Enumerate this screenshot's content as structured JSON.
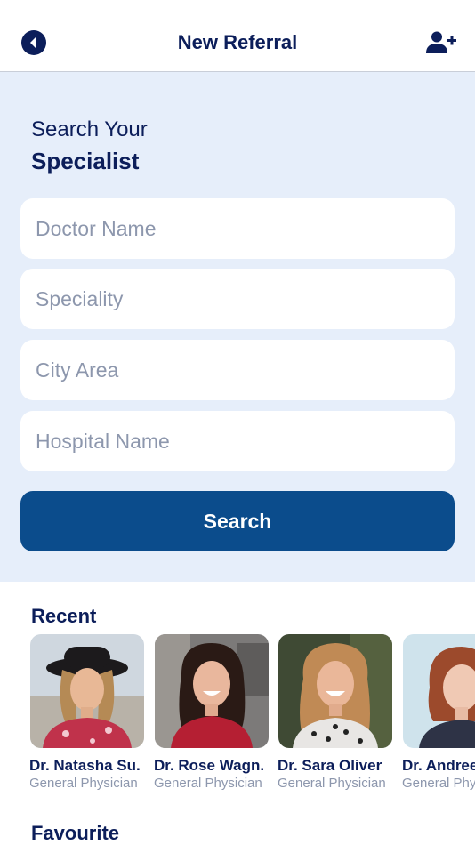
{
  "header": {
    "title": "New Referral",
    "back_icon": "back-arrow-icon",
    "add_icon": "add-user-icon"
  },
  "search": {
    "heading_line1": "Search Your",
    "heading_line2": "Specialist",
    "fields": [
      {
        "placeholder": "Doctor Name",
        "value": ""
      },
      {
        "placeholder": "Speciality",
        "value": ""
      },
      {
        "placeholder": "City Area",
        "value": ""
      },
      {
        "placeholder": "Hospital Name",
        "value": ""
      }
    ],
    "button_label": "Search"
  },
  "recent": {
    "title": "Recent",
    "doctors": [
      {
        "name": "Dr. Natasha Su.",
        "specialty": "General Physician"
      },
      {
        "name": "Dr. Rose Wagn.",
        "specialty": "General Physician"
      },
      {
        "name": "Dr. Sara Oliver",
        "specialty": "General Physician"
      },
      {
        "name": "Dr. Andree",
        "specialty": "General Physician"
      }
    ]
  },
  "favourite": {
    "title": "Favourite"
  },
  "colors": {
    "primary": "#0c1e5a",
    "button": "#0b4c8c",
    "section_bg": "#e6eefa",
    "placeholder": "#8d97ad"
  }
}
